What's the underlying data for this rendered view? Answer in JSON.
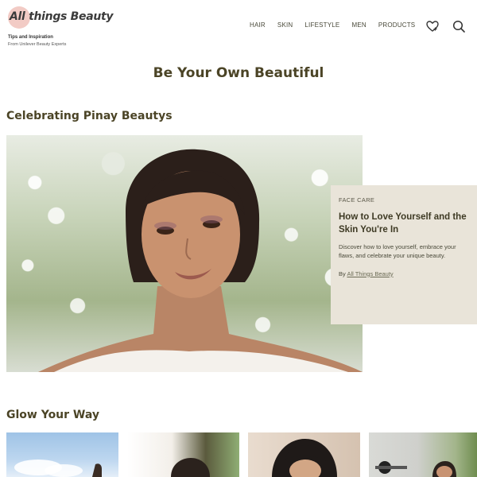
{
  "header": {
    "logo_text": "All things Beauty",
    "tagline": "Tips and Inspiration",
    "subtagline": "From Unilever Beauty Experts"
  },
  "nav": {
    "items": [
      "HAIR",
      "SKIN",
      "LIFESTYLE",
      "MEN",
      "PRODUCTS"
    ],
    "icons": [
      "favorites-heart-icon",
      "search-icon"
    ]
  },
  "hero": {
    "title": "Be Your Own Beautiful"
  },
  "sections": {
    "celebrating": {
      "title": "Celebrating Pinay Beautys"
    },
    "glow": {
      "title": "Glow Your Way"
    }
  },
  "feature_card": {
    "category": "FACE CARE",
    "title": "How to Love Yourself and the Skin You're In",
    "description": "Discover how to love yourself, embrace your flaws, and celebrate your unique beauty.",
    "byline_prefix": "By",
    "author": "All Things Beauty"
  },
  "colors": {
    "accent_text": "#4b4426",
    "card_bg": "#e9e4d9",
    "logo_circle": "#f2cbc5"
  }
}
